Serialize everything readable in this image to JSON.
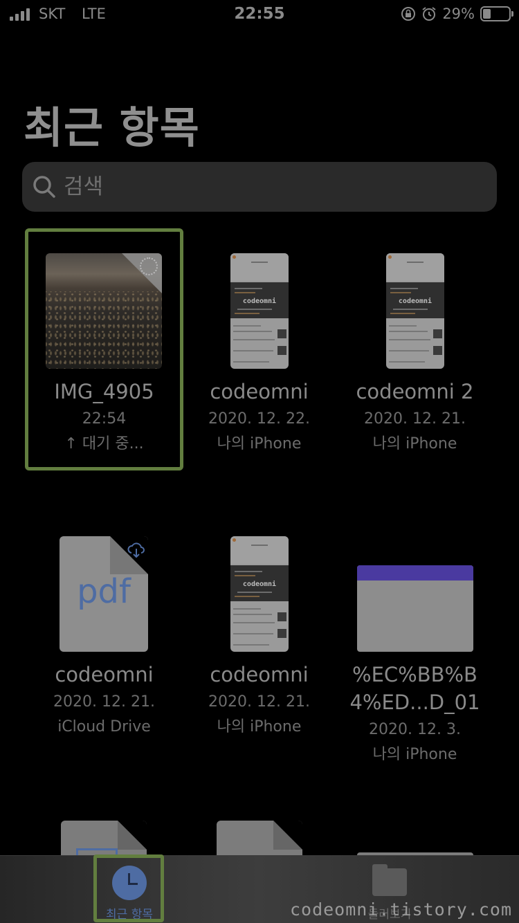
{
  "status_bar": {
    "carrier": "SKT",
    "network": "LTE",
    "time": "22:55",
    "battery_percent": "29%"
  },
  "title": "최근 항목",
  "search": {
    "placeholder": "검색"
  },
  "items": [
    {
      "name": "IMG_4905",
      "line1": "22:54",
      "line2": "↑ 대기 중..."
    },
    {
      "name": "codeomni",
      "line1": "2020. 12. 22.",
      "line2": "나의 iPhone",
      "thumb_label": "codeomni"
    },
    {
      "name": "codeomni 2",
      "line1": "2020. 12. 21.",
      "line2": "나의 iPhone",
      "thumb_label": "codeomni"
    },
    {
      "name": "codeomni",
      "line1": "2020. 12. 21.",
      "line2": "iCloud Drive",
      "thumb_label": "pdf"
    },
    {
      "name": "codeomni",
      "line1": "2020. 12. 21.",
      "line2": "나의 iPhone",
      "thumb_label": "codeomni"
    },
    {
      "name_line1": "%EC%BB%B",
      "name_line2": "4%ED...D_01",
      "line1": "2020. 12. 3.",
      "line2": "나의 iPhone"
    }
  ],
  "tabs": {
    "recent": "최근 항목",
    "browse": "둘러보기"
  },
  "watermark": "codeomni.tistory.com",
  "colors": {
    "accent": "#4e6ca3",
    "selection_outline": "#627e3f",
    "background": "#000000"
  }
}
